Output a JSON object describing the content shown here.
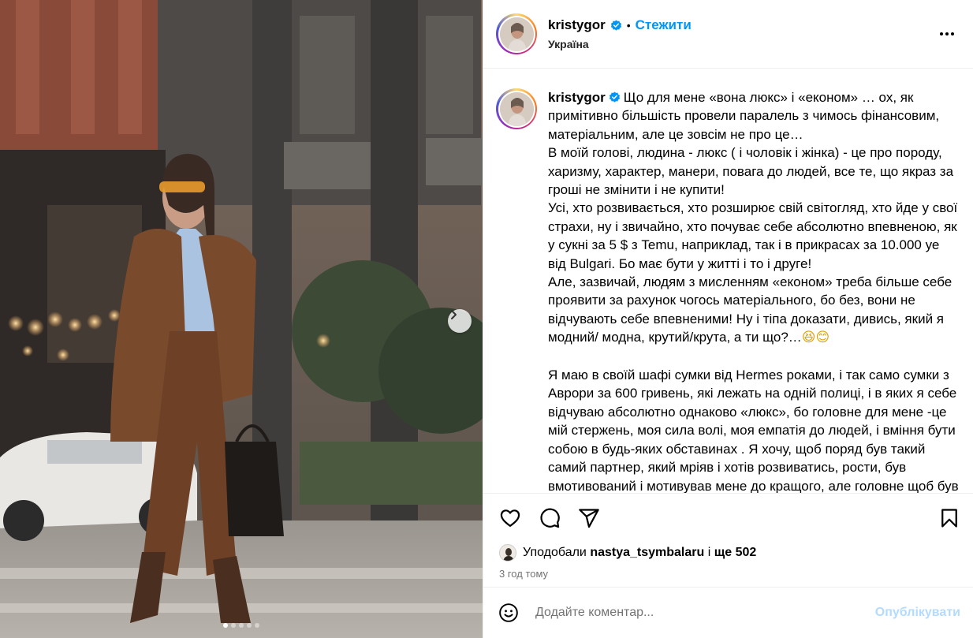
{
  "header": {
    "username": "kristygor",
    "separator": "•",
    "follow_label": "Стежити",
    "location": "Україна"
  },
  "caption": {
    "username": "kristygor",
    "paragraphs": [
      "Що для мене «вона люкс» і «економ» … ох, як примітивно більшість провели паралель з чимось фінансовим, матеріальним, але це зовсім не про це…",
      "В моїй голові, людина - люкс ( і чоловік і жінка) - це про породу, харизму, характер, манери, повага до людей, все те, що якраз за гроші не змінити і не купити!",
      "Усі, хто розвивається, хто розширює свій світогляд, хто йде у свої страхи, ну і звичайно, хто почуває себе абсолютно впевненою, як у сукні за 5 $ з Temu, наприклад, так і в прикрасах за 10.000 уе від Bulgari. Бо має бути у житті і то і друге!",
      "Але, зазвичай, людям з мисленням «економ» треба більше себе проявити за рахунок чогось матеріального, бо без, вони не відчувають себе впевненими! Ну і тіпа доказати, дивись, який я модний/ модна, крутий/крута, а ти що?…",
      "Я маю в своїй шафі сумки від Hermes роками, і так само сумки з Аврори за 600 гривень, які лежать на одній полиці, і в яких я себе відчуваю абсолютно однаково «люкс», бо головне для мене -це мій стержень, моя сила волі, моя емпатія до людей, і вміння бути собою в будь-яких обставинах . Я хочу, щоб поряд був такий самий партнер, який мріяв і хотів розвиватись, рости, був вмотивований і мотивував мене до кращого, але головне щоб був поруч в будь-яких ситуаціях і був собою, а не тим, хто себе"
    ],
    "emojis": "😆😊"
  },
  "likes": {
    "prefix": "Уподобали",
    "user": "nastya_tsymbalaru",
    "middle": "і",
    "rest": "ще 502"
  },
  "timestamp": "3 год тому",
  "comment": {
    "placeholder": "Додайте коментар...",
    "publish_label": "Опублікувати"
  },
  "carousel": {
    "slide_count": 5,
    "active_index": 0
  },
  "colors": {
    "accent": "#0095f6",
    "publish_disabled": "#b3dbff",
    "muted": "#737373"
  },
  "icons": [
    "heart-icon",
    "comment-icon",
    "share-icon",
    "bookmark-icon",
    "emoji-icon",
    "more-icon",
    "verified-icon",
    "chevron-right-icon"
  ]
}
